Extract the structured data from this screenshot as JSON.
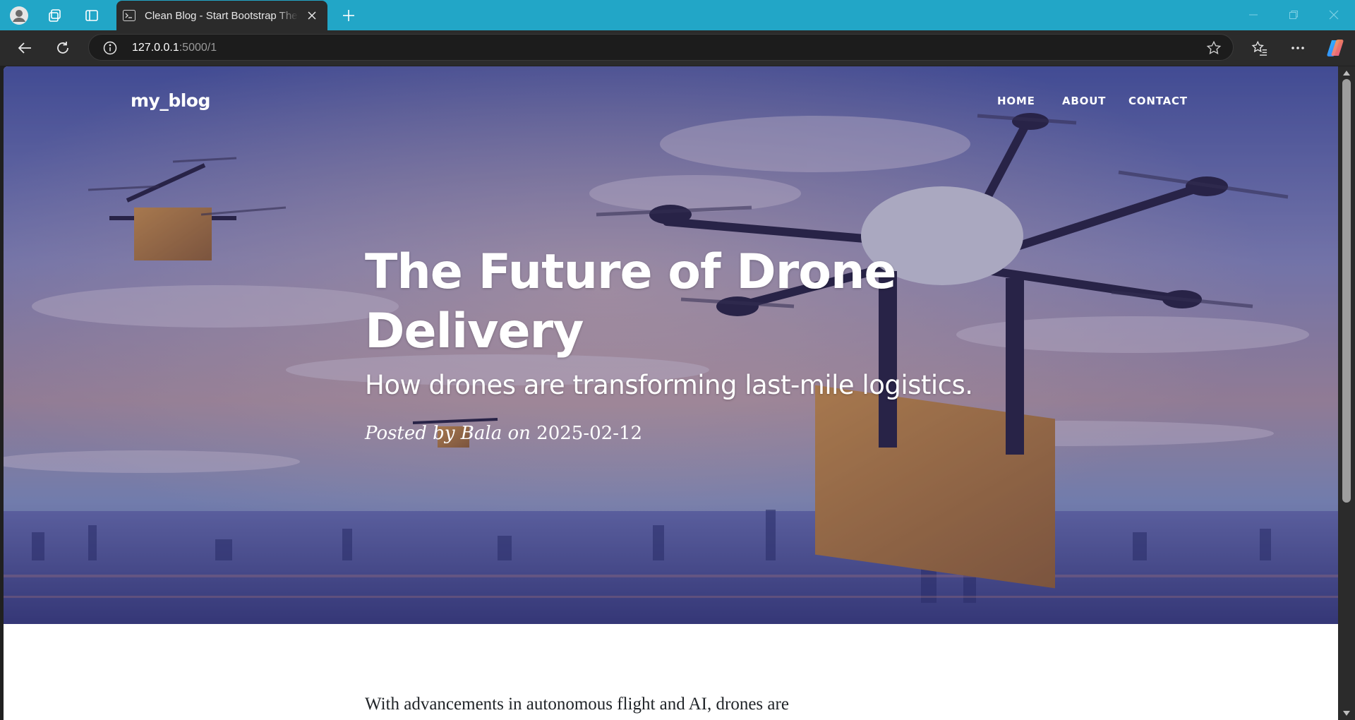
{
  "browser": {
    "tab_title": "Clean Blog - Start Bootstrap Theme",
    "url_host": "127.0.0.1",
    "url_path": ":5000/1",
    "icons": {
      "profile": "profile-icon",
      "workspaces": "workspaces-icon",
      "tab_actions": "tab-actions-icon",
      "favicon": "terminal-favicon-icon",
      "close_tab": "close-icon",
      "new_tab": "plus-icon",
      "back": "back-arrow-icon",
      "refresh": "refresh-icon",
      "site_info": "info-icon",
      "favorite": "star-icon",
      "favorites": "favorites-icon",
      "more": "more-icon",
      "copilot": "copilot-icon"
    },
    "colors": {
      "tabbar": "#22a6c7",
      "toolbar": "#2b2b2b"
    }
  },
  "site": {
    "brand": "my_blog",
    "nav": [
      {
        "label": "HOME"
      },
      {
        "label": "ABOUT"
      },
      {
        "label": "CONTACT"
      }
    ]
  },
  "post": {
    "title": "The Future of Drone Delivery",
    "subtitle": "How drones are transforming last-mile logistics.",
    "meta_prefix": "Posted by ",
    "author": "Bala",
    "meta_mid": " on ",
    "date": "2025-02-12",
    "body_first_line": "With advancements in autonomous flight and AI, drones are"
  }
}
